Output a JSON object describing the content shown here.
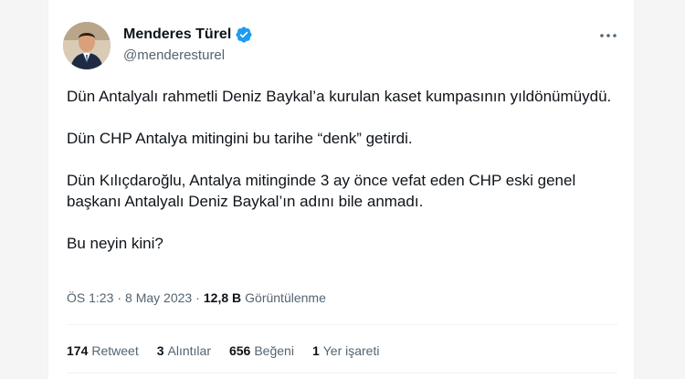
{
  "author": {
    "name": "Menderes Türel",
    "handle": "@menderesturel"
  },
  "tweet": {
    "paragraphs": [
      "Dün Antalyalı rahmetli Deniz Baykal’a kurulan kaset kumpasının yıldönümüydü.",
      "Dün CHP Antalya mitingini bu tarihe “denk” getirdi.",
      "Dün Kılıçdaroğlu, Antalya mitinginde 3 ay önce vefat eden CHP eski genel başkanı Antalyalı Deniz Baykal’ın adını bile anmadı.",
      "Bu neyin kini?"
    ]
  },
  "meta": {
    "time": "ÖS 1:23",
    "separator": "·",
    "date": "8 May 2023",
    "views_count": "12,8 B",
    "views_label": "Görüntülenme"
  },
  "stats": {
    "retweets_count": "174",
    "retweets_label": "Retweet",
    "quotes_count": "3",
    "quotes_label": "Alıntılar",
    "likes_count": "656",
    "likes_label": "Beğeni",
    "bookmarks_count": "1",
    "bookmarks_label": "Yer işareti"
  },
  "colors": {
    "verified": "#1d9bf0",
    "text_primary": "#0f1419",
    "text_secondary": "#536471",
    "border": "#eff3f4"
  },
  "icons": {
    "verified": "verified-badge-icon",
    "more": "more-horizontal-icon"
  }
}
